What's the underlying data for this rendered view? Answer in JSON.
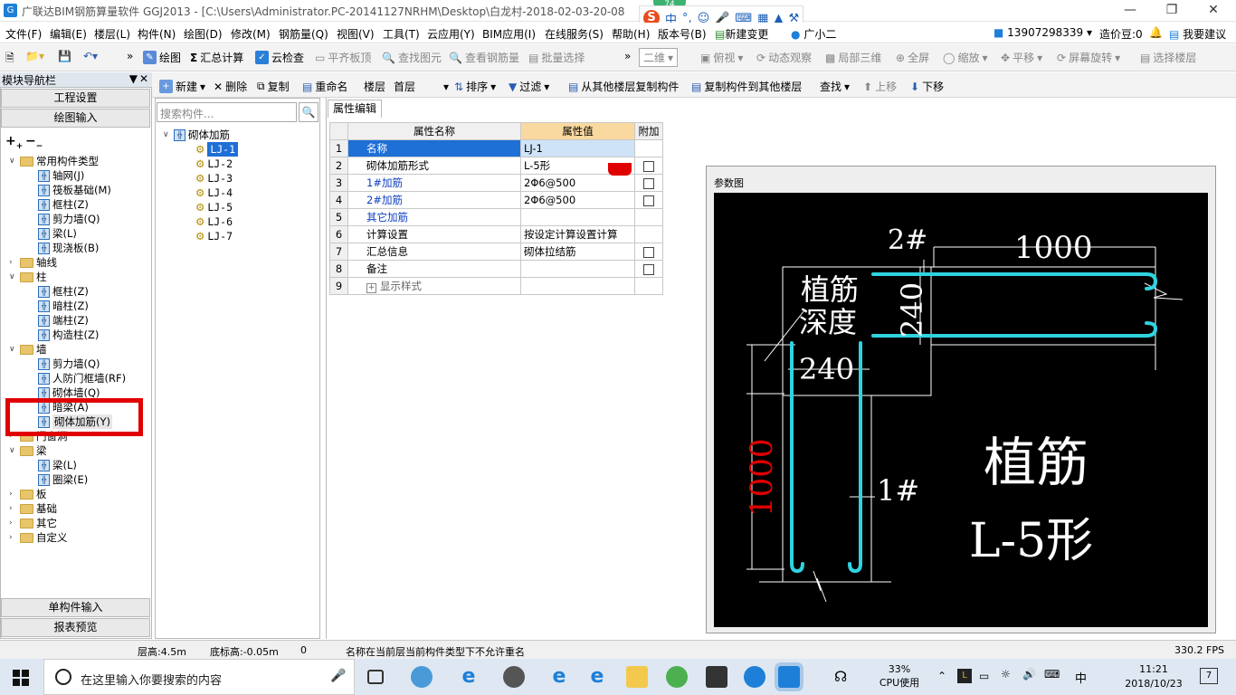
{
  "title_bar": {
    "app_title": "广联达BIM钢筋算量软件 GGJ2013 - [C:\\Users\\Administrator.PC-20141127NRHM\\Desktop\\白龙村-2018-02-03-20-08",
    "badge": "74"
  },
  "ime": {
    "label": "中"
  },
  "menu": {
    "items": [
      "文件(F)",
      "编辑(E)",
      "楼层(L)",
      "构件(N)",
      "绘图(D)",
      "修改(M)",
      "钢筋量(Q)",
      "视图(V)",
      "工具(T)",
      "云应用(Y)",
      "BIM应用(I)",
      "在线服务(S)",
      "帮助(H)",
      "版本号(B)",
      "新建变更",
      "广小二"
    ],
    "phone": "13907298339",
    "cost_beans": "造价豆:0",
    "feedback": "我要建议"
  },
  "toolbar1": {
    "items": [
      "绘图",
      "汇总计算",
      "云检查",
      "平齐板顶",
      "查找图元",
      "查看钢筋量",
      "批量选择",
      "二维",
      "俯视",
      "动态观察",
      "局部三维",
      "全屏",
      "缩放",
      "平移",
      "屏幕旋转",
      "选择楼层"
    ]
  },
  "nav": {
    "header": "模块导航栏",
    "btn_project_settings": "工程设置",
    "btn_draw_input": "绘图输入",
    "btn_single_input": "单构件输入",
    "btn_report_preview": "报表预览",
    "tree": [
      {
        "label": "常用构件类型",
        "level": 0,
        "type": "folder",
        "expanded": true
      },
      {
        "label": "轴网(J)",
        "level": 1,
        "type": "item"
      },
      {
        "label": "筏板基础(M)",
        "level": 1,
        "type": "item"
      },
      {
        "label": "框柱(Z)",
        "level": 1,
        "type": "item"
      },
      {
        "label": "剪力墙(Q)",
        "level": 1,
        "type": "item"
      },
      {
        "label": "梁(L)",
        "level": 1,
        "type": "item"
      },
      {
        "label": "现浇板(B)",
        "level": 1,
        "type": "item"
      },
      {
        "label": "轴线",
        "level": 0,
        "type": "folder",
        "expanded": false
      },
      {
        "label": "柱",
        "level": 0,
        "type": "folder",
        "expanded": true
      },
      {
        "label": "框柱(Z)",
        "level": 1,
        "type": "item"
      },
      {
        "label": "暗柱(Z)",
        "level": 1,
        "type": "item"
      },
      {
        "label": "端柱(Z)",
        "level": 1,
        "type": "item"
      },
      {
        "label": "构造柱(Z)",
        "level": 1,
        "type": "item"
      },
      {
        "label": "墙",
        "level": 0,
        "type": "folder",
        "expanded": true
      },
      {
        "label": "剪力墙(Q)",
        "level": 1,
        "type": "item"
      },
      {
        "label": "人防门框墙(RF)",
        "level": 1,
        "type": "item"
      },
      {
        "label": "砌体墙(Q)",
        "level": 1,
        "type": "item"
      },
      {
        "label": "暗梁(A)",
        "level": 1,
        "type": "item"
      },
      {
        "label": "砌体加筋(Y)",
        "level": 1,
        "type": "item",
        "selected": true
      },
      {
        "label": "门窗洞",
        "level": 0,
        "type": "folder",
        "expanded": false
      },
      {
        "label": "梁",
        "level": 0,
        "type": "folder",
        "expanded": true
      },
      {
        "label": "梁(L)",
        "level": 1,
        "type": "item"
      },
      {
        "label": "圈梁(E)",
        "level": 1,
        "type": "item"
      },
      {
        "label": "板",
        "level": 0,
        "type": "folder",
        "expanded": false
      },
      {
        "label": "基础",
        "level": 0,
        "type": "folder",
        "expanded": false
      },
      {
        "label": "其它",
        "level": 0,
        "type": "folder",
        "expanded": false
      },
      {
        "label": "自定义",
        "level": 0,
        "type": "folder",
        "expanded": false
      }
    ]
  },
  "toolbar2": {
    "items": [
      "新建",
      "删除",
      "复制",
      "重命名",
      "楼层",
      "首层",
      "排序",
      "过滤",
      "从其他楼层复制构件",
      "复制构件到其他楼层",
      "查找",
      "上移",
      "下移"
    ]
  },
  "component_list": {
    "search_placeholder": "搜索构件...",
    "root": "砌体加筋",
    "items": [
      "LJ-1",
      "LJ-2",
      "LJ-3",
      "LJ-4",
      "LJ-5",
      "LJ-6",
      "LJ-7"
    ],
    "selected": "LJ-1"
  },
  "properties": {
    "tab": "属性编辑",
    "col_name": "属性名称",
    "col_value": "属性值",
    "col_add": "附加",
    "rows": [
      {
        "idx": "1",
        "name": "名称",
        "value": "LJ-1",
        "blue": false,
        "checkbox": false
      },
      {
        "idx": "2",
        "name": "砌体加筋形式",
        "value": "L-5形",
        "blue": false,
        "checkbox": true
      },
      {
        "idx": "3",
        "name": "1#加筋",
        "value": "2Φ6@500",
        "blue": true,
        "checkbox": true
      },
      {
        "idx": "4",
        "name": "2#加筋",
        "value": "2Φ6@500",
        "blue": true,
        "checkbox": true
      },
      {
        "idx": "5",
        "name": "其它加筋",
        "value": "",
        "blue": true,
        "checkbox": false
      },
      {
        "idx": "6",
        "name": "计算设置",
        "value": "按设定计算设置计算",
        "blue": false,
        "checkbox": false
      },
      {
        "idx": "7",
        "name": "汇总信息",
        "value": "砌体拉结筋",
        "blue": false,
        "checkbox": true
      },
      {
        "idx": "8",
        "name": "备注",
        "value": "",
        "blue": false,
        "checkbox": true
      },
      {
        "idx": "9",
        "name": "显示样式",
        "value": "",
        "blue": false,
        "checkbox": false
      }
    ]
  },
  "diagram": {
    "title": "参数图",
    "label_2": "2#",
    "dim_top": "1000",
    "text_anchor_depth_1": "植筋",
    "text_anchor_depth_2": "深度",
    "dim_240_v": "240",
    "dim_240_h": "240",
    "dim_left": "1000",
    "label_1": "1#",
    "big_title_1": "植筋",
    "big_title_2": "L-5形"
  },
  "status": {
    "floor_height": "层高:4.5m",
    "bottom_elev": "底标高:-0.05m",
    "zero": "0",
    "message": "名称在当前层当前构件类型下不允许重名",
    "fps": "330.2 FPS"
  },
  "taskbar": {
    "search_text": "在这里输入你要搜索的内容",
    "cpu": "33%",
    "cpu_label": "CPU使用",
    "ime": "中",
    "time": "11:21",
    "date": "2018/10/23",
    "notifications": "7"
  }
}
